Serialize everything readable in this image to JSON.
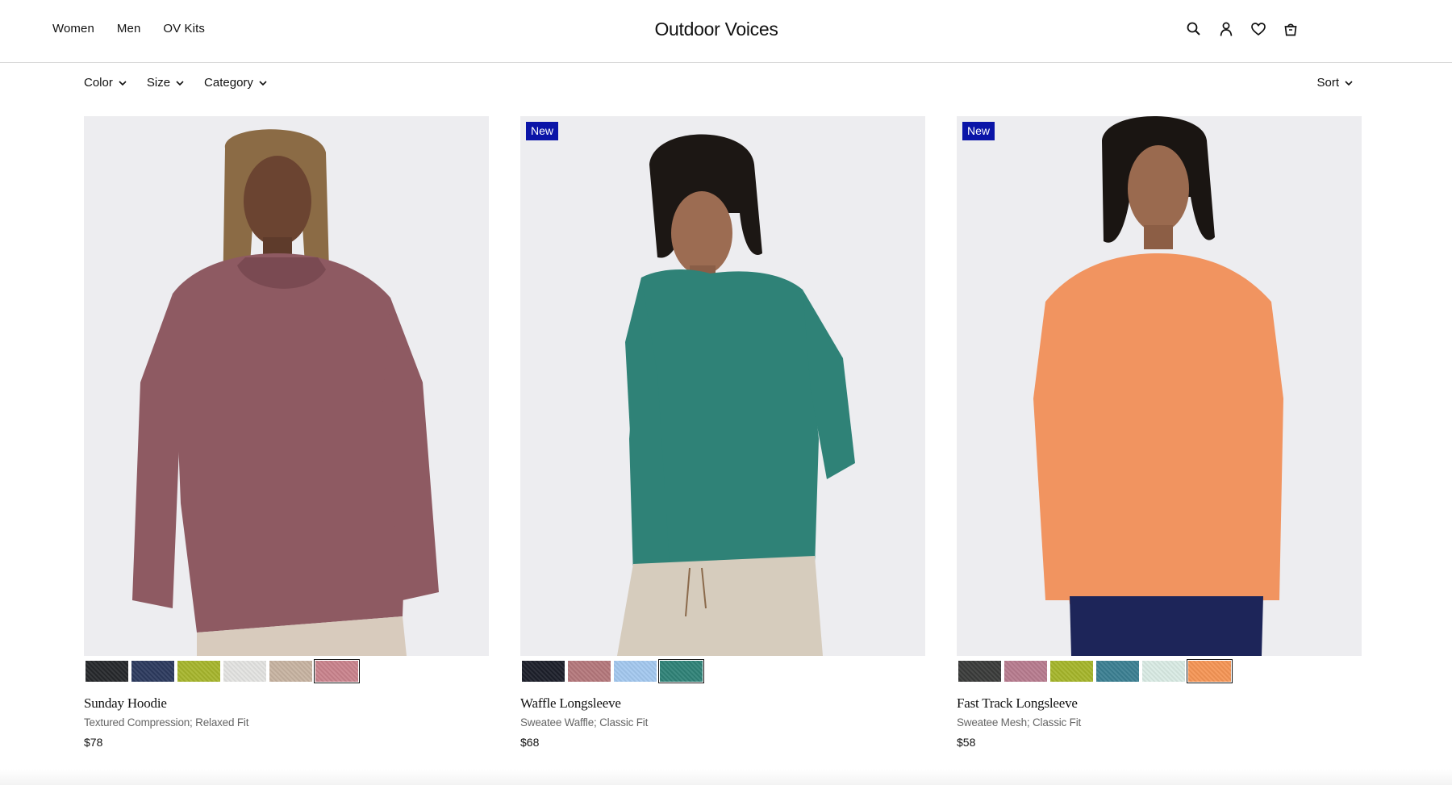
{
  "header": {
    "nav": [
      "Women",
      "Men",
      "OV Kits"
    ],
    "logo": "Outdoor Voices",
    "icons": [
      "search-icon",
      "account-icon",
      "wishlist-heart-icon",
      "cart-bag-icon"
    ]
  },
  "filters": {
    "items": [
      "Color",
      "Size",
      "Category"
    ],
    "sort_label": "Sort"
  },
  "products": [
    {
      "badge": "",
      "name": "Sunday Hoodie",
      "description": "Textured Compression; Relaxed Fit",
      "price": "$78",
      "garment_color": "#8e5a62",
      "swatches": [
        "#26282b",
        "#2c3a5e",
        "#a6b52c",
        "#e3e3e1",
        "#c7b3a1",
        "#c9828c"
      ],
      "selected_swatch": 5
    },
    {
      "badge": "New",
      "name": "Waffle Longsleeve",
      "description": "Sweatee Waffle; Classic Fit",
      "price": "$68",
      "garment_color": "#2f8277",
      "swatches": [
        "#1c1f2a",
        "#b4777b",
        "#a3c8ef",
        "#2f8277"
      ],
      "selected_swatch": 3
    },
    {
      "badge": "New",
      "name": "Fast Track Longsleeve",
      "description": "Sweatee Mesh; Classic Fit",
      "price": "$58",
      "garment_color": "#f19460",
      "swatches": [
        "#3a3b3a",
        "#b77b8e",
        "#a5b52a",
        "#3b7f92",
        "#d9ebe4",
        "#f59555"
      ],
      "selected_swatch": 5
    }
  ],
  "colors": {
    "badge_bg": "#0b15a8",
    "photo_bg": "#ececef"
  }
}
